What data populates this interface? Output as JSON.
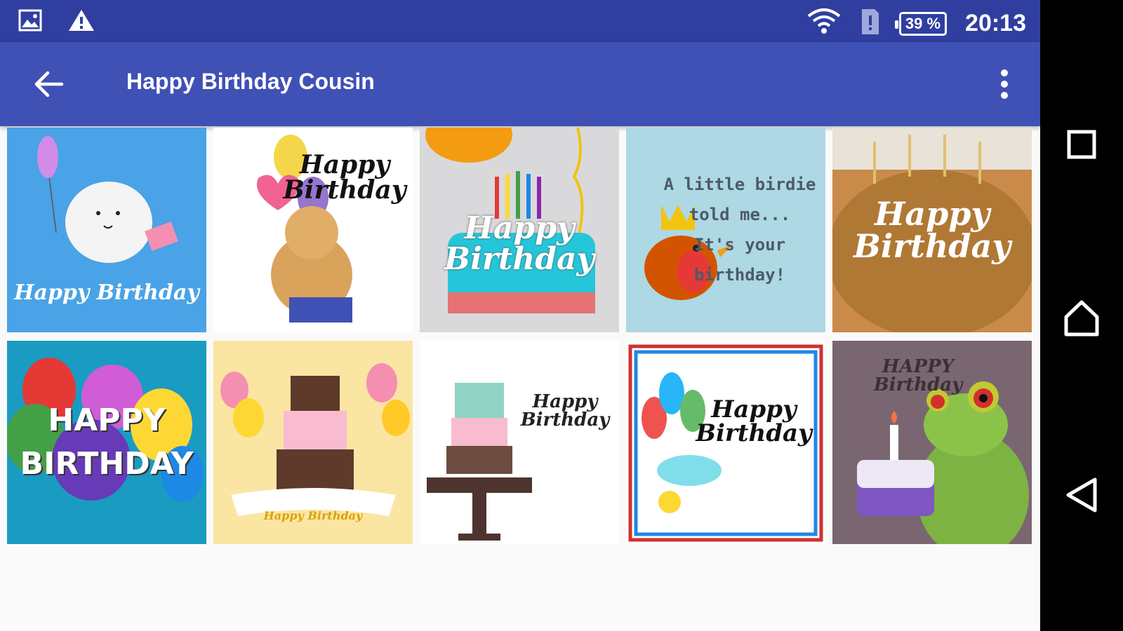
{
  "status_bar": {
    "time": "20:13",
    "battery": "39 %"
  },
  "app_bar": {
    "title": "Happy Birthday Cousin"
  },
  "cards": [
    {
      "caption": "Happy Birthday",
      "bg": "#4aa3e6",
      "text_color": "#ffffff"
    },
    {
      "caption": "Happy\nBirthday",
      "bg": "#ffffff",
      "text_color": "#111111"
    },
    {
      "caption": "Happy\nBirthday",
      "bg": "#d9d9dc",
      "text_color": "#ffffff"
    },
    {
      "caption": "A little birdie told me...\nIt's your\nbirthday!",
      "bg": "#aed8e3",
      "text_color": "#4b5b6b"
    },
    {
      "caption": "Happy\nBirthday",
      "bg": "#c98a4a",
      "text_color": "#ffffff"
    },
    {
      "caption": "HAPPY\nBIRTHDAY",
      "bg": "#1a9bc2",
      "text_color": "#ffffff"
    },
    {
      "caption": "Happy Birthday",
      "bg": "#fbe5a3",
      "text_color": "#d9a300"
    },
    {
      "caption": "Happy\nBirthday",
      "bg": "#ffffff",
      "text_color": "#222222"
    },
    {
      "caption": "Happy\nBirthday",
      "bg": "#ffffff",
      "text_color": "#111111"
    },
    {
      "caption": "HAPPY\nBirthday",
      "bg": "#7a6670",
      "text_color": "#3a3035"
    }
  ]
}
